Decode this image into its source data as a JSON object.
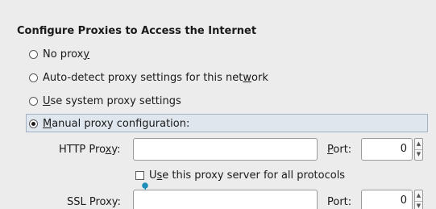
{
  "section": {
    "title": "Configure Proxies to Access the Internet"
  },
  "options": [
    {
      "pre": "No prox",
      "key": "y",
      "post": "",
      "checked": false
    },
    {
      "pre": "Auto-detect proxy settings for this net",
      "key": "w",
      "post": "ork",
      "checked": false
    },
    {
      "pre": "",
      "key": "U",
      "post": "se system proxy settings",
      "checked": false
    },
    {
      "pre": "",
      "key": "M",
      "post": "anual proxy configuration:",
      "checked": true
    }
  ],
  "http": {
    "label_pre": "HTTP Pro",
    "label_key": "x",
    "label_post": "y:",
    "value": "",
    "port_label_key": "P",
    "port_label_post": "ort:",
    "port_value": "0"
  },
  "use_for_all": {
    "pre": "U",
    "key": "s",
    "post": "e this proxy server for all protocols",
    "checked": false
  },
  "ssl": {
    "label": "SSL Proxy:",
    "value": "",
    "port_label": "Port:",
    "port_value": "0"
  },
  "colors": {
    "selection_bg": "#dfe6ee",
    "selection_border": "#a4b3c4",
    "pointer": "#1b8fb8"
  }
}
